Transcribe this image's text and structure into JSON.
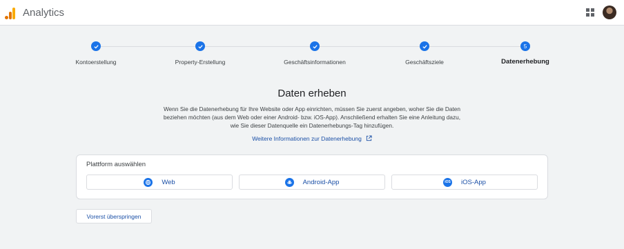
{
  "header": {
    "app_title": "Analytics",
    "logo_icon": "analytics-logo-icon",
    "apps_icon": "apps-grid-icon",
    "avatar_icon": "user-avatar"
  },
  "stepper": {
    "steps": [
      {
        "label": "Kontoerstellung",
        "state": "done",
        "marker": ""
      },
      {
        "label": "Property-Erstellung",
        "state": "done",
        "marker": ""
      },
      {
        "label": "Geschäftsinformationen",
        "state": "done",
        "marker": ""
      },
      {
        "label": "Geschäftsziele",
        "state": "done",
        "marker": ""
      },
      {
        "label": "Datenerhebung",
        "state": "current",
        "marker": "5"
      }
    ]
  },
  "main": {
    "title": "Daten erheben",
    "description_lines": [
      "Wenn Sie die Datenerhebung für Ihre Website oder App einrichten, müssen Sie zuerst angeben, woher Sie die Daten",
      "beziehen möchten (aus dem Web oder einer Android- bzw. iOS-App). Anschließend erhalten Sie eine Anleitung dazu,",
      "wie Sie dieser Datenquelle ein Datenerhebungs-Tag hinzufügen."
    ],
    "more_info_link": "Weitere Informationen zur Datenerhebung",
    "platform_card": {
      "title": "Plattform auswählen",
      "options": [
        {
          "label": "Web",
          "icon": "globe-icon"
        },
        {
          "label": "Android-App",
          "icon": "android-icon"
        },
        {
          "label": "iOS-App",
          "icon": "ios-icon",
          "icon_text": "iOS"
        }
      ]
    },
    "skip_button": "Vorerst überspringen"
  },
  "colors": {
    "accent": "#1a73e8",
    "link": "#1a4fa6",
    "background": "#f1f3f4",
    "logo_orange": "#e37400",
    "logo_yellow": "#f9ab00"
  }
}
